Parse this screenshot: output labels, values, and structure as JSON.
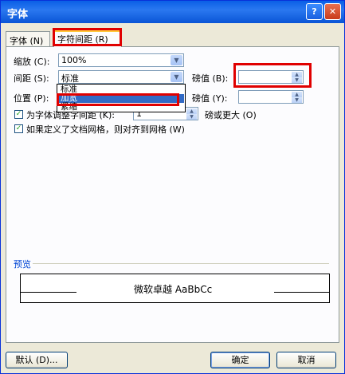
{
  "window": {
    "title": "字体",
    "help_icon": "?",
    "close_icon": "✕"
  },
  "tabs": [
    {
      "label": "字体 (N)"
    },
    {
      "label": "字符间距 (R)",
      "active": true
    }
  ],
  "fields": {
    "scale": {
      "label": "缩放 (C):",
      "value": "100%"
    },
    "spacing": {
      "label": "间距 (S):",
      "value": "标准"
    },
    "spacing_by": {
      "label": "磅值 (B):",
      "value": ""
    },
    "position": {
      "label": "位置 (P):",
      "value": ""
    },
    "position_by": {
      "label": "磅值 (Y):",
      "value": ""
    },
    "kerning": {
      "label": "为字体调整字间距 (K):",
      "value": "1",
      "suffix": "磅或更大 (O)",
      "checked": true
    },
    "grid": {
      "label": "如果定义了文档网格，则对齐到网格 (W)",
      "checked": true
    }
  },
  "spacing_dropdown": {
    "options": [
      "标准",
      "加宽",
      "紧缩"
    ],
    "selected": "加宽"
  },
  "preview": {
    "label": "预览",
    "sample": "微软卓越  AaBbCc"
  },
  "buttons": {
    "default": "默认 (D)...",
    "ok": "确定",
    "cancel": "取消"
  },
  "colors": {
    "title_bar": "#0a5fe6",
    "highlight": "#e00000",
    "selection": "#316ac5"
  }
}
